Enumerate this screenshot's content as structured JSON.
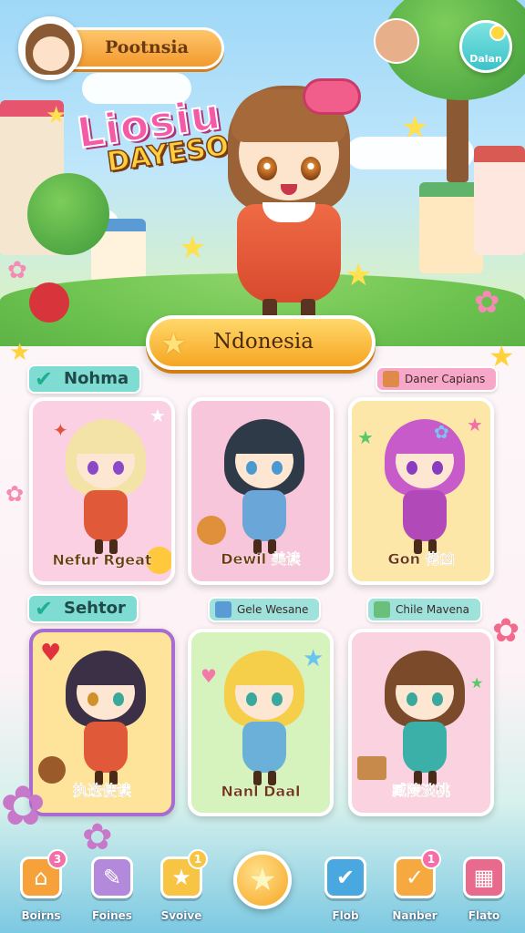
{
  "header": {
    "profile_name": "Pootnsia",
    "map_label": "Dalan"
  },
  "title": {
    "main": "Liosiu",
    "sub": "DAYESO"
  },
  "region_button": {
    "label": "Ndonesia"
  },
  "sections": [
    {
      "tag": "Nohma",
      "chip": "Daner Capians",
      "cards": [
        {
          "name": "Nefur Rgeat",
          "bg": "#fbd0e2",
          "hair": "#f4e3a6",
          "outfit": "#e05a3a",
          "eye": "#8a4ac8"
        },
        {
          "name": "Dewil 美读",
          "bg": "#f8c6db",
          "hair": "#2f3a48",
          "outfit": "#6aa7d8",
          "eye": "#4a9ad0"
        },
        {
          "name": "Gon 佬凶",
          "bg": "#fde7a8",
          "hair": "#c65bc9",
          "outfit": "#b14ab8",
          "eye": "#8a3cc0"
        }
      ]
    },
    {
      "tag": "Sehtor",
      "chips": [
        "Gele Wesane",
        "Chile Mavena"
      ],
      "cards": [
        {
          "name": "执迭使读",
          "bg": "#fde49a",
          "hair": "#3b3046",
          "outfit": "#e05a3a",
          "eye": "#d0902a",
          "border": "#a86bd2"
        },
        {
          "name": "Nanl Daal",
          "bg": "#d6f3bd",
          "hair": "#f5cf4a",
          "outfit": "#6ab0d8",
          "eye": "#3aa89a"
        },
        {
          "name": "臧陵淡桃",
          "bg": "#fbd2e0",
          "hair": "#7a4a2a",
          "outfit": "#3bb0a8",
          "eye": "#3aa89a"
        }
      ]
    }
  ],
  "bottom_nav": [
    {
      "label": "Boirns",
      "icon": "house-icon",
      "badge": "3",
      "color": "#f7a13a"
    },
    {
      "label": "Foines",
      "icon": "notepad-icon",
      "badge": "",
      "color": "#b38adb"
    },
    {
      "label": "Svoive",
      "icon": "star-box-icon",
      "badge": "1",
      "color": "#f8c444"
    },
    {
      "label": "Flob",
      "icon": "check-icon",
      "badge": "",
      "color": "#4aa8e0"
    },
    {
      "label": "Nanber",
      "icon": "checkmark-box-icon",
      "badge": "1",
      "color": "#f6a93e"
    },
    {
      "label": "Flato",
      "icon": "calendar-icon",
      "badge": "",
      "color": "#e86a8c"
    }
  ]
}
